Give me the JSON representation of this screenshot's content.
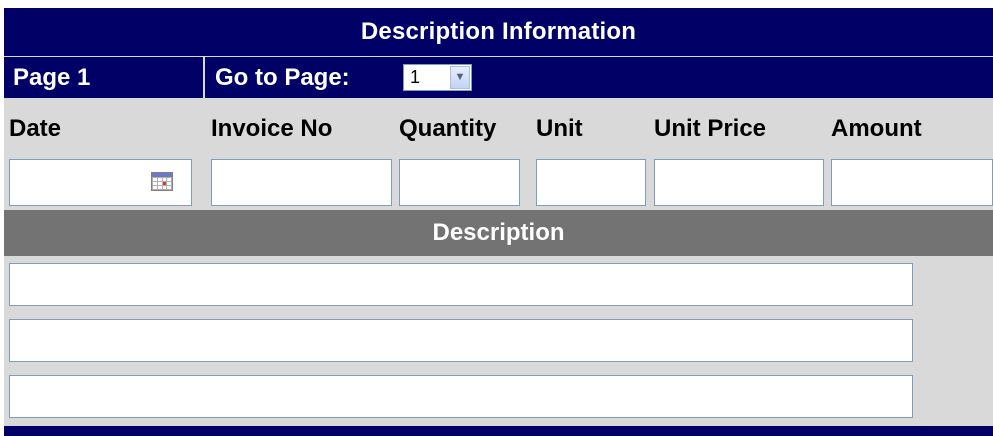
{
  "header": {
    "title": "Description Information"
  },
  "nav": {
    "page_label": "Page 1",
    "goto_label": "Go to Page:",
    "page_select_value": "1"
  },
  "columns": {
    "date": "Date",
    "invoice_no": "Invoice No",
    "quantity": "Quantity",
    "unit": "Unit",
    "unit_price": "Unit Price",
    "amount": "Amount"
  },
  "fields": {
    "date_value": "",
    "invoice_no_value": "",
    "quantity_value": "",
    "unit_value": "",
    "unit_price_value": "",
    "amount_value": ""
  },
  "description": {
    "header": "Description",
    "lines": [
      "",
      "",
      ""
    ]
  },
  "icons": {
    "calendar": "calendar-icon",
    "dropdown": "chevron-down-icon"
  },
  "colors": {
    "header_bg": "#000066",
    "subheader_bg": "#737373",
    "panel_bg": "#d9d9d9",
    "field_border": "#7f9db9"
  }
}
